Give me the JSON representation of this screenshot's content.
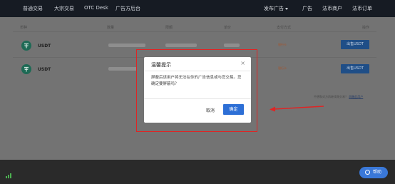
{
  "nav": {
    "items": [
      "普通交易",
      "大宗交易",
      "OTC Desk",
      "广告方后台"
    ],
    "right": [
      "发布广告",
      "广告",
      "法币商户",
      "法币订单"
    ]
  },
  "table": {
    "headers": [
      "币种",
      "数量",
      "限额",
      "单价",
      "支付方式",
      "操作"
    ],
    "rows": [
      {
        "coin": "USDT",
        "pay": "银行卡",
        "action": "出售USDT"
      },
      {
        "coin": "USDT",
        "pay": "银行卡",
        "action": "出售USDT"
      }
    ],
    "no_trade_prefix": "不想和对方再继续做交易？",
    "no_trade_link": "屏蔽此用户"
  },
  "dialog": {
    "title": "温馨提示",
    "close": "×",
    "message": "屏蔽后该用户将无法在你的广告信息或与您交易。您确定要屏蔽吗？",
    "cancel": "取消",
    "confirm": "确定"
  },
  "help": {
    "label": "帮助"
  },
  "colors": {
    "annotation": "#e02424",
    "primary": "#2d6fd6",
    "nav_bg": "#161b23"
  }
}
